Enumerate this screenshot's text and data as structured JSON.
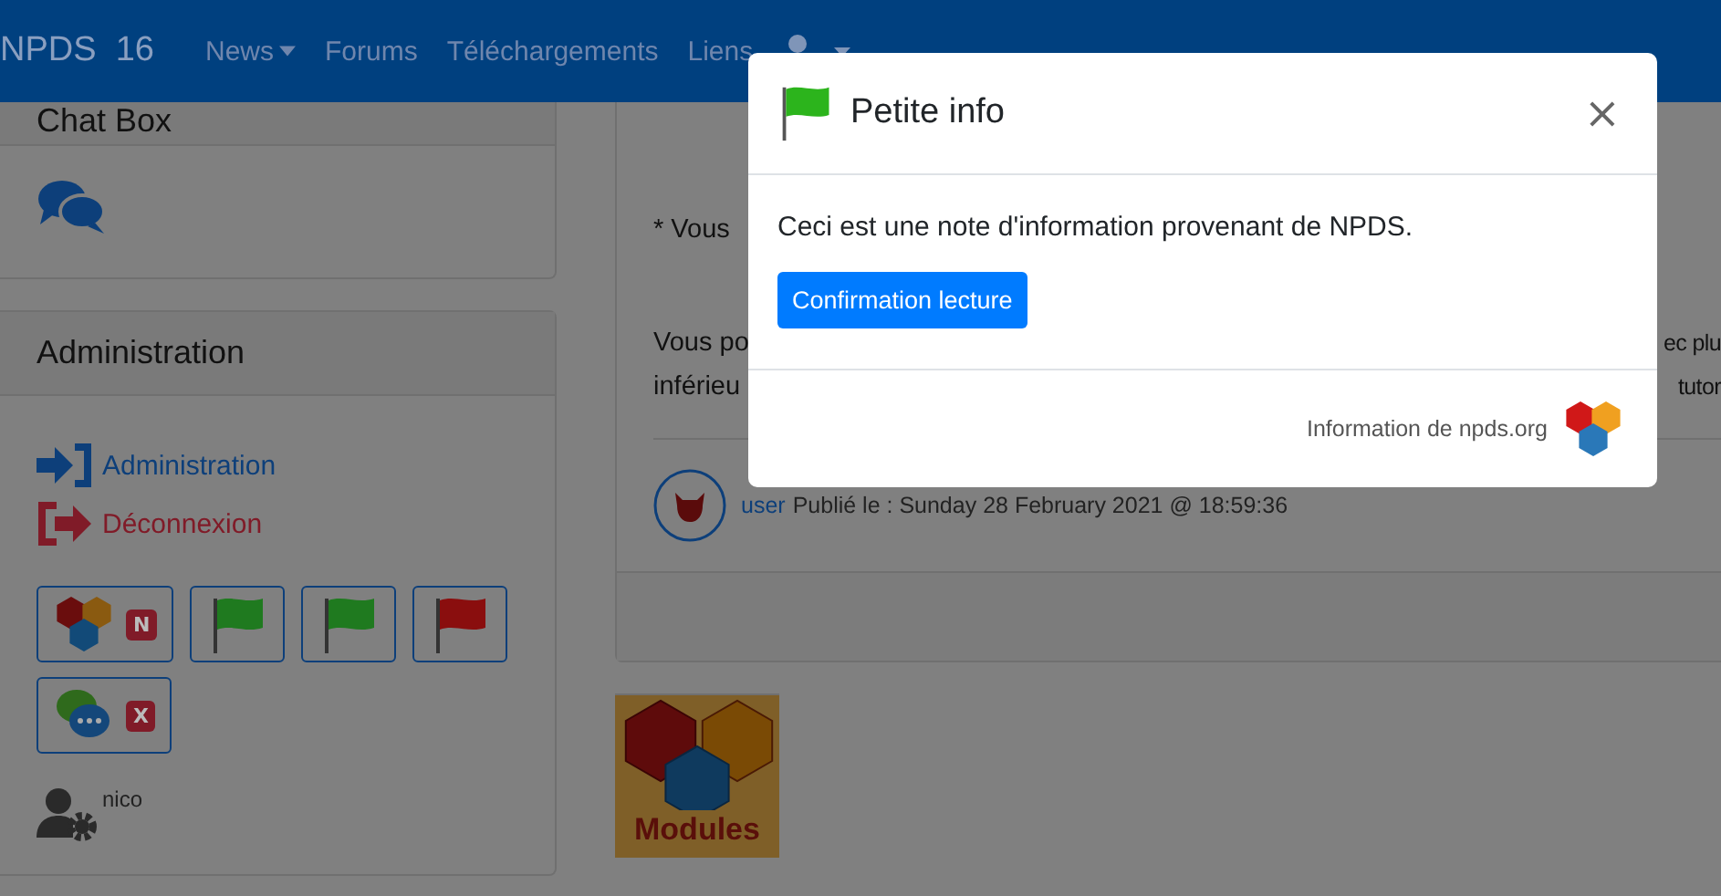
{
  "navbar": {
    "brand": "NPDS",
    "version": "16",
    "items": [
      {
        "label": "News",
        "dropdown": true
      },
      {
        "label": "Forums",
        "dropdown": false
      },
      {
        "label": "Téléchargements",
        "dropdown": false
      },
      {
        "label": "Liens",
        "dropdown": false
      }
    ]
  },
  "sidebar": {
    "chat_box": {
      "title": "Chat Box"
    },
    "administration": {
      "title": "Administration",
      "links": [
        {
          "label": "Administration",
          "kind": "login"
        },
        {
          "label": "Déconnexion",
          "kind": "logout"
        }
      ],
      "shortcuts": [
        {
          "kind": "npds",
          "badge": "N"
        },
        {
          "kind": "flag",
          "color": "#1f7a1f"
        },
        {
          "kind": "flag",
          "color": "#1f7a1f"
        },
        {
          "kind": "flag",
          "color": "#8a0e0e"
        },
        {
          "kind": "chat",
          "badge": "X"
        }
      ],
      "user": "nico"
    }
  },
  "article": {
    "lines": [
      {
        "left": "* Vous"
      },
      {
        "left": "Vous po",
        "right": "ec plu"
      },
      {
        "left": "inférieu",
        "right": "tutor"
      }
    ],
    "author": "user",
    "published": "Publié le : Sunday 28 February 2021 @ 18:59:36"
  },
  "modules_tile": {
    "label": "Modules"
  },
  "modal": {
    "title": "Petite info",
    "close": "×",
    "message": "Ceci est une note d'information provenant de NPDS.",
    "button": "Confirmation lecture",
    "footer": "Information de npds.org"
  }
}
